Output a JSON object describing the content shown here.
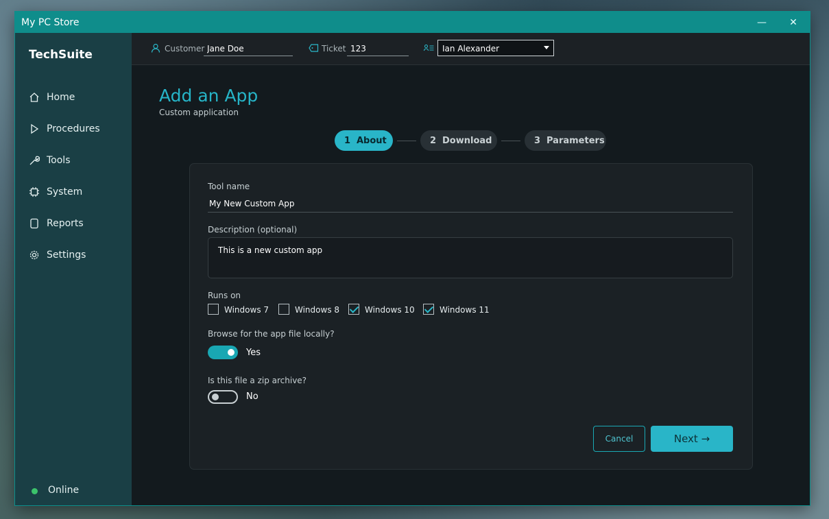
{
  "window": {
    "title": "My PC Store",
    "minimize_glyph": "—",
    "close_glyph": "✕"
  },
  "sidebar": {
    "brand": "TechSuite",
    "items": [
      {
        "label": "Home",
        "icon": "home-icon"
      },
      {
        "label": "Procedures",
        "icon": "play-icon"
      },
      {
        "label": "Tools",
        "icon": "wrench-icon"
      },
      {
        "label": "System",
        "icon": "chip-icon"
      },
      {
        "label": "Reports",
        "icon": "document-icon"
      },
      {
        "label": "Settings",
        "icon": "gear-icon"
      }
    ],
    "status": {
      "label": "Online",
      "color": "#3cc36b"
    }
  },
  "topbar": {
    "customer_label": "Customer",
    "customer_value": "Jane Doe",
    "ticket_label": "Ticket",
    "ticket_value": "123",
    "technician_value": "Ian Alexander"
  },
  "page": {
    "title": "Add an App",
    "subtitle": "Custom application",
    "steps": [
      {
        "num": "1",
        "label": "About",
        "active": true
      },
      {
        "num": "2",
        "label": "Download",
        "active": false
      },
      {
        "num": "3",
        "label": "Parameters",
        "active": false
      }
    ]
  },
  "form": {
    "tool_name_label": "Tool name",
    "tool_name_value": "My New Custom App",
    "description_label": "Description (optional)",
    "description_value": "This is a new custom app",
    "runs_on_label": "Runs on",
    "os_options": [
      {
        "label": "Windows 7",
        "checked": false
      },
      {
        "label": "Windows 8",
        "checked": false
      },
      {
        "label": "Windows 10",
        "checked": true
      },
      {
        "label": "Windows 11",
        "checked": true
      }
    ],
    "browse_label": "Browse for the app file locally?",
    "browse_state": "Yes",
    "zip_label": "Is this file a zip archive?",
    "zip_state": "No",
    "cancel_label": "Cancel",
    "next_label": "Next →"
  },
  "colors": {
    "accent": "#29b5c8",
    "titlebar": "#0f8d8b",
    "sidebar": "#1a3f45"
  }
}
